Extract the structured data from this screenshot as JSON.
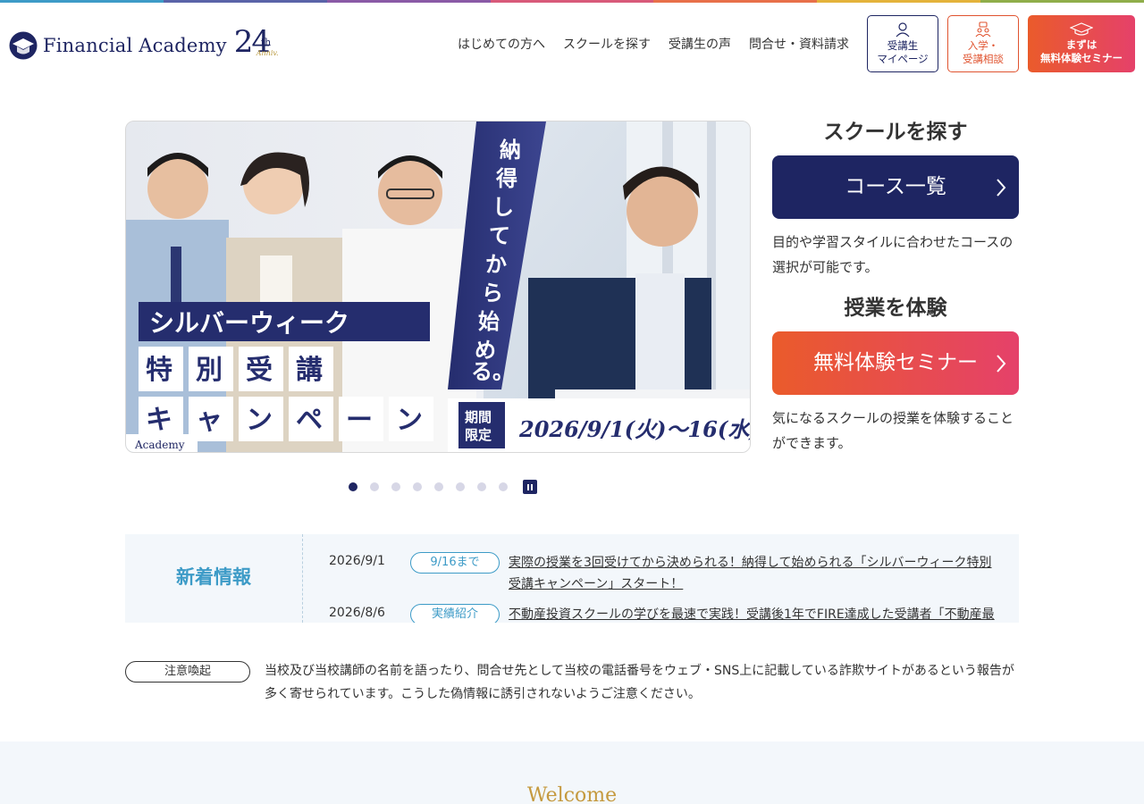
{
  "colors": {
    "navy": "#1e2562",
    "orange": "#ea5b2b",
    "pink": "#e5416a",
    "teal": "#3d9bc7",
    "gold": "#c59a3f",
    "topbar": [
      "#3d9bc7",
      "#5a63a8",
      "#8a5aa6",
      "#d85a7a",
      "#e8704a",
      "#e4b33b",
      "#8fae4a"
    ]
  },
  "header": {
    "logo_text": "Financial Academy",
    "anniv_number": "24",
    "anniv_suffix": "th",
    "anniv_sub": "Anniv.",
    "nav": [
      "はじめての方へ",
      "スクールを探す",
      "受講生の声",
      "問合せ・資料請求"
    ],
    "mypage_line1": "受講生",
    "mypage_line2": "マイページ",
    "consult_line1": "入学・",
    "consult_line2": "受講相談",
    "seminar_line1": "まずは",
    "seminar_line2": "無料体験セミナー"
  },
  "hero": {
    "banner_title": "シルバーウィーク",
    "banner_sub1": "特別受講",
    "banner_sub2": "キャンペーン",
    "vertical_copy": "納得してから始める。",
    "period_tag": "期間限定",
    "period_text": "2026/9/1(火)〜16(水)",
    "logo_fragment": "Academy",
    "slide_count": 8,
    "active_slide": 1
  },
  "side": {
    "find_title": "スクールを探す",
    "course_button": "コース一覧",
    "course_desc": "目的や学習スタイルに合わせたコースの選択が可能です。",
    "trial_title": "授業を体験",
    "trial_button": "無料体験セミナー",
    "trial_desc": "気になるスクールの授業を体験することができます。"
  },
  "news": {
    "title": "新着情報",
    "items": [
      {
        "date": "2026/9/1",
        "tag": "9/16まで",
        "text": "実際の授業を3回受けてから決められる！納得して始められる「シルバーウィーク特別受講キャンペーン」スタート！"
      },
      {
        "date": "2026/8/6",
        "tag": "実績紹介",
        "text": "不動産投資スクールの学びを最速で実践！受講後1年でFIRE達成した受講者「不動産最"
      }
    ]
  },
  "caution": {
    "badge": "注意喚起",
    "text": "当校及び当校講師の名前を語ったり、問合せ先として当校の電話番号をウェブ・SNS上に記載している詐欺サイトがあるという報告が多く寄せられています。こうした偽情報に誘引されないようご注意ください。"
  },
  "welcome": {
    "title": "Welcome"
  }
}
